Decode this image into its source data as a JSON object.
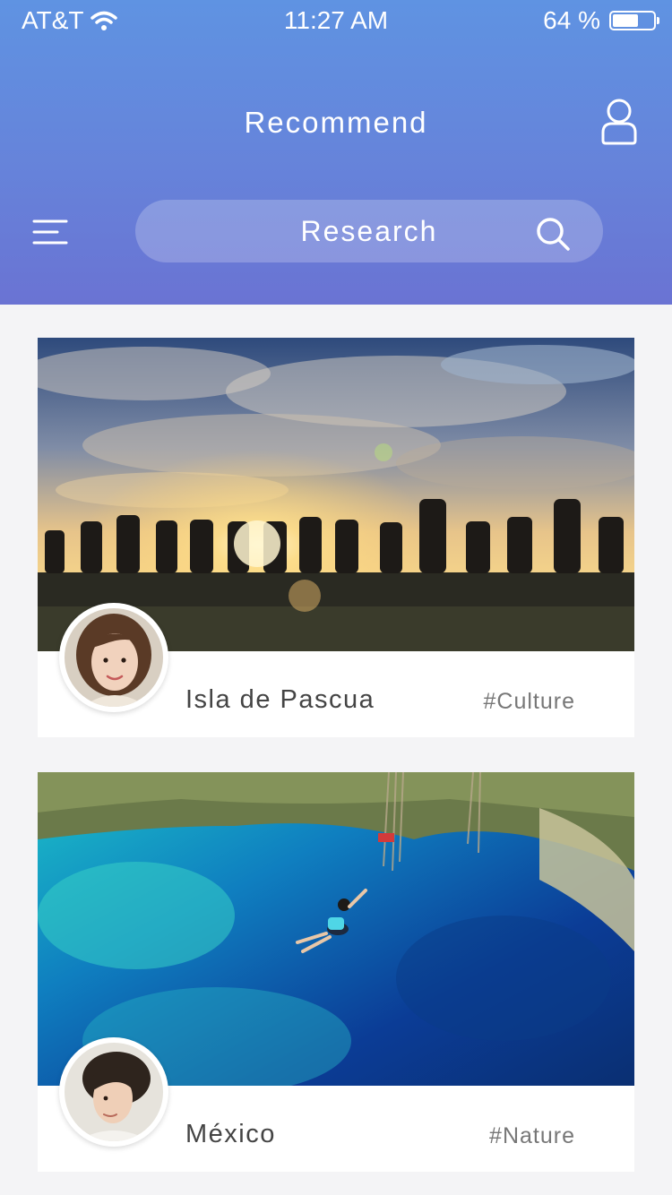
{
  "status_bar": {
    "carrier": "AT&T",
    "time": "11:27 AM",
    "battery": "64 %",
    "battery_level": 0.64
  },
  "header": {
    "title": "Recommend",
    "search_placeholder": "Research"
  },
  "icons": [
    "wifi-icon",
    "battery-icon",
    "user-icon",
    "menu-icon",
    "search-icon"
  ],
  "colors": {
    "header_top": "#5f93e2",
    "header_bottom": "#6a73d3",
    "background": "#f4f4f6"
  },
  "cards": [
    {
      "place": "Isla de Pascua",
      "tag": "#Culture"
    },
    {
      "place": "México",
      "tag": "#Nature"
    }
  ]
}
